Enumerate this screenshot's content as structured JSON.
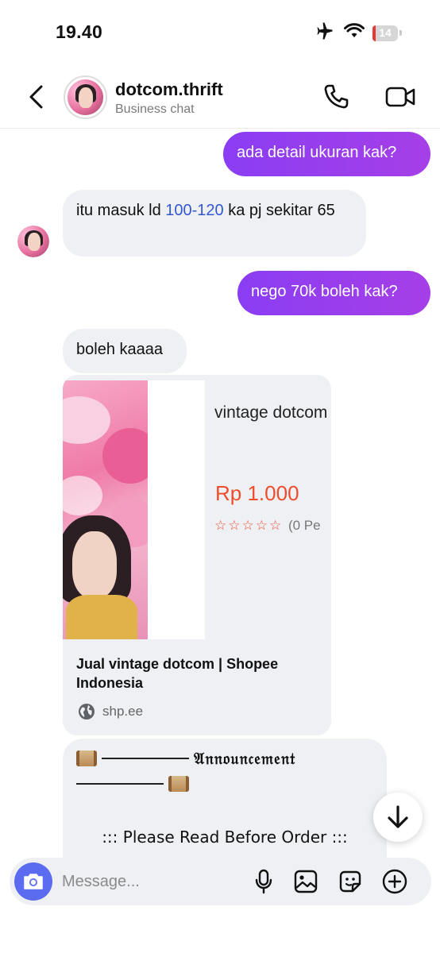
{
  "status_bar": {
    "time": "19.40",
    "battery": "14",
    "battery_level_percent": 14,
    "icons": [
      "airplane-icon",
      "wifi-icon",
      "battery-icon"
    ]
  },
  "header": {
    "contact_name": "dotcom.thrift",
    "subtitle": "Business chat",
    "actions": [
      "phone-icon",
      "video-camera-icon"
    ]
  },
  "messages": [
    {
      "direction": "outgoing",
      "text": "ada detail ukuran kak?"
    },
    {
      "direction": "incoming",
      "text_before": "itu masuk ld ",
      "link": "100-120",
      "text_after": " ka pj sekitar 65"
    },
    {
      "direction": "outgoing",
      "text": "nego 70k boleh kak?"
    },
    {
      "direction": "incoming",
      "text": "boleh kaaaa"
    }
  ],
  "link_card": {
    "product_title": "vintage dotcom",
    "price": "Rp 1.000",
    "stars": "☆☆☆☆☆",
    "rating_count": "(0 Pe",
    "title": "Jual vintage dotcom | Shopee Indonesia",
    "domain": "shp.ee"
  },
  "announcement": {
    "heading": "𝔄𝔫𝔫𝔬𝔲𝔫𝔠𝔢𝔪𝔢𝔫𝔱",
    "line": "::: Please Read Before Order :::"
  },
  "composer": {
    "placeholder": "Message...",
    "buttons": [
      "camera-icon",
      "microphone-icon",
      "image-icon",
      "sticker-icon",
      "plus-icon"
    ]
  },
  "colors": {
    "outgoing_bubble": "#8a3df3",
    "incoming_bubble": "#eef0f3",
    "price": "#ee4d2d",
    "link": "#3457d5",
    "camera_button": "#5b6cf0"
  }
}
